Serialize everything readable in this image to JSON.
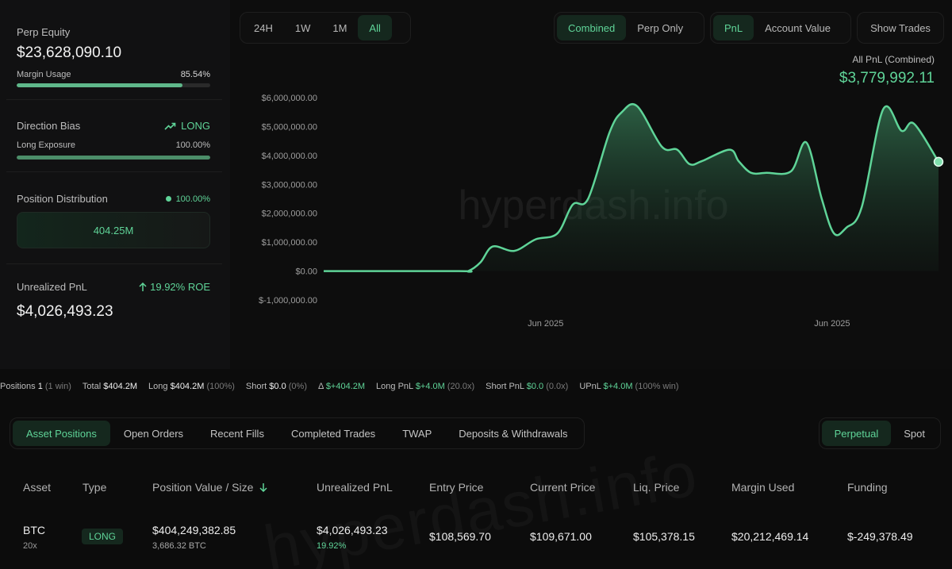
{
  "left": {
    "perp_equity_label": "Perp Equity",
    "perp_equity_value": "$23,628,090.10",
    "margin_usage_label": "Margin Usage",
    "margin_usage_value": "85.54%",
    "margin_usage_fraction": 0.8554,
    "direction_bias_label": "Direction Bias",
    "direction_bias_value": "LONG",
    "long_exposure_label": "Long Exposure",
    "long_exposure_value": "100.00%",
    "long_exposure_fraction": 1.0,
    "position_distribution_label": "Position Distribution",
    "position_distribution_pct": "100.00%",
    "position_distribution_amount": "404.25M",
    "unrealized_pnl_label": "Unrealized PnL",
    "unrealized_pnl_roe": "19.92% ROE",
    "unrealized_pnl_value": "$4,026,493.23"
  },
  "controls": {
    "range": [
      "24H",
      "1W",
      "1M",
      "All"
    ],
    "range_active": "All",
    "mode": [
      "Combined",
      "Perp Only"
    ],
    "mode_active": "Combined",
    "metric": [
      "PnL",
      "Account Value"
    ],
    "metric_active": "PnL",
    "show_trades": "Show Trades"
  },
  "chart_header": {
    "label": "All PnL (Combined)",
    "value": "$3,779,992.11"
  },
  "watermark": "hyperdash.info",
  "chart_data": {
    "type": "area",
    "title": "All PnL (Combined)",
    "ylim": [
      -1000000,
      6000000
    ],
    "y_ticks": [
      6000000,
      5000000,
      4000000,
      3000000,
      2000000,
      1000000,
      0,
      -1000000
    ],
    "y_tick_labels": [
      "$6,000,000.00",
      "$5,000,000.00",
      "$4,000,000.00",
      "$3,000,000.00",
      "$2,000,000.00",
      "$1,000,000.00",
      "$0.00",
      "$-1,000,000.00"
    ],
    "x_tick_labels": [
      "Jun 2025",
      "Jun 2025"
    ],
    "x_tick_positions": [
      0.361,
      0.827
    ],
    "grid": false,
    "color": "#5fd498",
    "series": [
      {
        "x": [
          0,
          0.22,
          0.235,
          0.255,
          0.275,
          0.31,
          0.345,
          0.38,
          0.405,
          0.43,
          0.465,
          0.485,
          0.51,
          0.55,
          0.575,
          0.595,
          0.615,
          0.66,
          0.675,
          0.695,
          0.72,
          0.76,
          0.785,
          0.81,
          0.83,
          0.85,
          0.875,
          0.91,
          0.94,
          0.96,
          1.0
        ],
        "values": [
          0,
          0,
          0,
          300000,
          850000,
          700000,
          1100000,
          1300000,
          2300000,
          2500000,
          4800000,
          5500000,
          5700000,
          4300000,
          4200000,
          3700000,
          3800000,
          4200000,
          3800000,
          3400000,
          3400000,
          3450000,
          4450000,
          2500000,
          1300000,
          1500000,
          2200000,
          5600000,
          4850000,
          5100000,
          3780000
        ]
      }
    ]
  },
  "stats": [
    {
      "label": "Positions",
      "value": "1",
      "note": "(1 win)"
    },
    {
      "label": "Total",
      "value": "$404.2M",
      "note": ""
    },
    {
      "label": "Long",
      "value": "$404.2M",
      "note": "(100%)"
    },
    {
      "label": "Short",
      "value": "$0.0",
      "note": "(0%)"
    },
    {
      "label": "Δ",
      "value": "$+404.2M",
      "note": "",
      "green": true
    },
    {
      "label": "Long PnL",
      "value": "$+4.0M",
      "note": "(20.0x)",
      "green": true
    },
    {
      "label": "Short PnL",
      "value": "$0.0",
      "note": "(0.0x)",
      "green": true
    },
    {
      "label": "UPnL",
      "value": "$+4.0M",
      "note": "(100% win)",
      "green": true
    }
  ],
  "tabs": [
    "Asset Positions",
    "Open Orders",
    "Recent Fills",
    "Completed Trades",
    "TWAP",
    "Deposits & Withdrawals"
  ],
  "tabs_active": "Asset Positions",
  "market_tabs": [
    "Perpetual",
    "Spot"
  ],
  "market_active": "Perpetual",
  "table": {
    "headers": [
      "Asset",
      "Type",
      "Position Value / Size",
      "Unrealized PnL",
      "Entry Price",
      "Current Price",
      "Liq. Price",
      "Margin Used",
      "Funding"
    ],
    "sort_icon": "arrow-down-icon",
    "row": {
      "asset": "BTC",
      "leverage": "20x",
      "type": "LONG",
      "position_value": "$404,249,382.85",
      "position_size": "3,686.32 BTC",
      "unrealized_pnl": "$4,026,493.23",
      "unrealized_pct": "19.92%",
      "entry_price": "$108,569.70",
      "current_price": "$109,671.00",
      "liq_price": "$105,378.15",
      "margin_used": "$20,212,469.14",
      "funding": "$-249,378.49"
    }
  }
}
